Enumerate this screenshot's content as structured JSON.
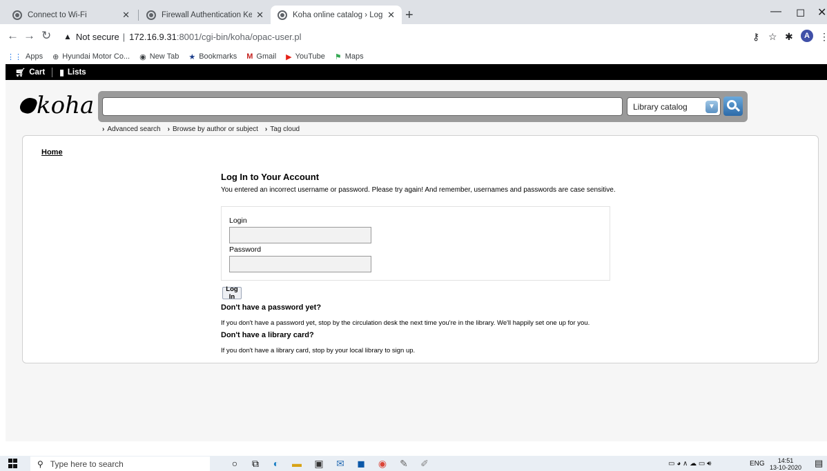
{
  "browser": {
    "tabs": [
      {
        "title": "Connect to Wi-Fi",
        "active": false
      },
      {
        "title": "Firewall Authentication Keepalive",
        "active": false
      },
      {
        "title": "Koha online catalog › Log in to y",
        "active": true
      }
    ],
    "new_tab_symbol": "+",
    "window_controls": [
      "—",
      "◻",
      "✕"
    ],
    "address": {
      "security_label": "Not secure",
      "host": "172.16.9.31",
      "path": ":8001/cgi-bin/koha/opac-user.pl"
    },
    "avatar_initial": "A",
    "bookmarks": [
      {
        "label": "Apps",
        "icon": "apps-grid-icon"
      },
      {
        "label": "Hyundai Motor Co...",
        "icon": "hyundai-icon"
      },
      {
        "label": "New Tab",
        "icon": "globe-icon"
      },
      {
        "label": "Bookmarks",
        "icon": "star-icon"
      },
      {
        "label": "Gmail",
        "icon": "gmail-icon"
      },
      {
        "label": "YouTube",
        "icon": "youtube-icon"
      },
      {
        "label": "Maps",
        "icon": "maps-icon"
      }
    ]
  },
  "koha_nav": {
    "cart_label": "Cart",
    "lists_label": "Lists"
  },
  "header": {
    "logo_text": "koha",
    "search_value": "",
    "catalog_select": "Library catalog",
    "sublinks": [
      "Advanced search",
      "Browse by author or subject",
      "Tag cloud"
    ]
  },
  "breadcrumb": {
    "home": "Home"
  },
  "login": {
    "heading": "Log In to Your Account",
    "error": "You entered an incorrect username or password. Please try again! And remember, usernames and passwords are case sensitive.",
    "login_label": "Login",
    "login_value": "",
    "password_label": "Password",
    "password_value": "",
    "button": "Log In",
    "no_password_heading": "Don't have a password yet?",
    "no_password_text": "If you don't have a password yet, stop by the circulation desk the next time you're in the library. We'll happily set one up for you.",
    "no_card_heading": "Don't have a library card?",
    "no_card_text": "If you don't have a library card, stop by your local library to sign up."
  },
  "taskbar": {
    "search_placeholder": "Type here to search",
    "language": "ENG",
    "time": "14:51",
    "date": "13-10-2020"
  }
}
